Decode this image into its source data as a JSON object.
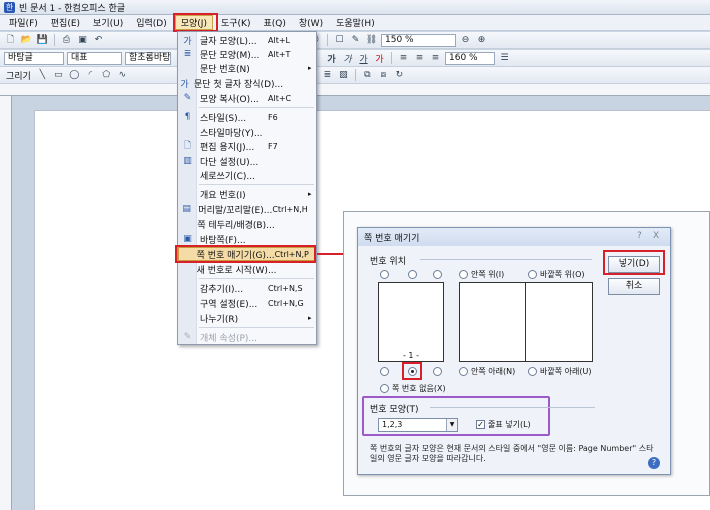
{
  "window": {
    "title": "빈 문서 1 - 한컴오피스 한글",
    "app_icon": "hwp-icon"
  },
  "menubar": {
    "items": [
      "파일(F)",
      "편집(E)",
      "보기(U)",
      "입력(D)",
      "모양(J)",
      "도구(K)",
      "표(Q)",
      "창(W)",
      "도움말(H)"
    ],
    "active_index": 4
  },
  "toolbar2": {
    "style_combo": "바탕글",
    "para_combo": "대표",
    "font_combo": "함초롬바탕",
    "zoom": "150 %",
    "size": "160 %"
  },
  "toolbar3": {
    "label": "그리기"
  },
  "shape_menu": {
    "items": [
      {
        "label": "글자 모양(L)...",
        "shortcut": "Alt+L",
        "icon": "char-shape-icon"
      },
      {
        "label": "문단 모양(M)...",
        "shortcut": "Alt+T",
        "icon": "para-shape-icon"
      },
      {
        "label": "문단 번호(N)",
        "shortcut": "",
        "icon": "",
        "submenu": true
      },
      {
        "label": "문단 첫 글자 장식(D)...",
        "shortcut": "",
        "icon": "dropcap-icon"
      },
      {
        "label": "모양 복사(O)...",
        "shortcut": "Alt+C",
        "icon": "copy-shape-icon"
      },
      {
        "label": "스타일(S)...",
        "shortcut": "F6",
        "icon": "style-icon"
      },
      {
        "label": "스타일마당(Y)...",
        "shortcut": "",
        "icon": ""
      },
      {
        "label": "편집 용지(J)...",
        "shortcut": "F7",
        "icon": "page-setup-icon"
      },
      {
        "label": "다단 설정(U)...",
        "shortcut": "",
        "icon": "columns-icon"
      },
      {
        "label": "세로쓰기(C)...",
        "shortcut": "",
        "icon": ""
      },
      {
        "label": "개요 번호(I)",
        "shortcut": "",
        "icon": "",
        "submenu": true
      },
      {
        "label": "머리말/꼬리말(E)...",
        "shortcut": "Ctrl+N,H",
        "icon": "header-icon"
      },
      {
        "label": "쪽 테두리/배경(B)...",
        "shortcut": "",
        "icon": ""
      },
      {
        "label": "바탕쪽(F)...",
        "shortcut": "",
        "icon": "master-page-icon"
      },
      {
        "label": "쪽 번호 매기기(G)...",
        "shortcut": "Ctrl+N,P",
        "icon": "",
        "selected": true
      },
      {
        "label": "새 번호로 시작(W)...",
        "shortcut": "",
        "icon": ""
      },
      {
        "label": "감추기(I)...",
        "shortcut": "Ctrl+N,S",
        "icon": ""
      },
      {
        "label": "구역 설정(E)...",
        "shortcut": "Ctrl+N,G",
        "icon": ""
      },
      {
        "label": "나누기(R)",
        "shortcut": "",
        "icon": "",
        "submenu": true
      },
      {
        "label": "개체 속성(P)...",
        "shortcut": "",
        "icon": "object-props-icon",
        "disabled": true
      }
    ]
  },
  "dialog": {
    "title": "쪽 번호 매기기",
    "help_glyph": "?",
    "close_glyph": "X",
    "position_group": "번호 위치",
    "positions": {
      "top_inside": "안쪽 위(I)",
      "top_outside": "바깥쪽 위(O)",
      "bottom_inside": "안쪽 아래(N)",
      "bottom_outside": "바깥쪽 아래(U)",
      "none": "쪽 번호 없음(X)"
    },
    "preview_number": "- 1 -",
    "shape_group": "번호 모양(T)",
    "shape_value": "1,2,3",
    "dash_checkbox": "줄표 넣기(L)",
    "dash_checked": true,
    "ok": "넣기(D)",
    "cancel": "취소",
    "note": "쪽 번호의 글자 모양은 현재 문서의 스타일 중에서 \"영문 이름: Page Number\" 스타일의 영문 글자 모양을 따라갑니다."
  }
}
